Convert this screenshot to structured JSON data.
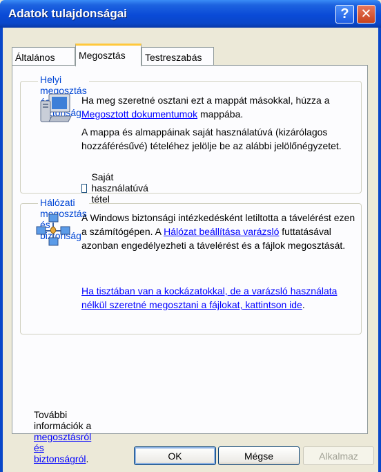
{
  "window": {
    "title": "Adatok tulajdonságai",
    "help_glyph": "?",
    "close_glyph": "✕"
  },
  "tabs": [
    {
      "label": "Általános",
      "active": false
    },
    {
      "label": "Megosztás",
      "active": true
    },
    {
      "label": "Testreszabás",
      "active": false
    }
  ],
  "local_section": {
    "legend": "Helyi megosztás és biztonság",
    "text1_a": "Ha meg szeretné osztani ezt a mappát másokkal, húzza a ",
    "text1_link": "Megosztott dokumentumok",
    "text1_b": " mappába.",
    "text2": "A mappa és almappáinak saját használatúvá (kizárólagos hozzáférésűvé) tételéhez jelölje be az alábbi jelölőnégyzetet.",
    "checkbox_label": "Saját használatúvá tétel",
    "checkbox_checked": false,
    "icon": "computer-icon"
  },
  "network_section": {
    "legend": "Hálózati megosztás és biztonság",
    "text1_a": "A Windows biztonsági intézkedésként letiltotta a távelérést ezen a számítógépen. A ",
    "text1_link": "Hálózat beállítása varázsló",
    "text1_b": " futtatásával azonban engedélyezheti a távelérést és a fájlok megosztását.",
    "link2": "Ha tisztában van a kockázatokkal, de a varázsló használata nélkül szeretné megosztani a fájlokat, kattintson ide",
    "link2_tail": ".",
    "icon": "network-icon"
  },
  "footer": {
    "text_a": "További információk a ",
    "link": "megosztásról és biztonságról",
    "text_b": "."
  },
  "buttons": {
    "ok": "OK",
    "cancel": "Mégse",
    "apply": "Alkalmaz",
    "apply_enabled": false
  },
  "colors": {
    "titlebar": "#0a47c9",
    "dialog_bg": "#ece9d8",
    "legend": "#0046d5",
    "link": "#0000ff"
  }
}
